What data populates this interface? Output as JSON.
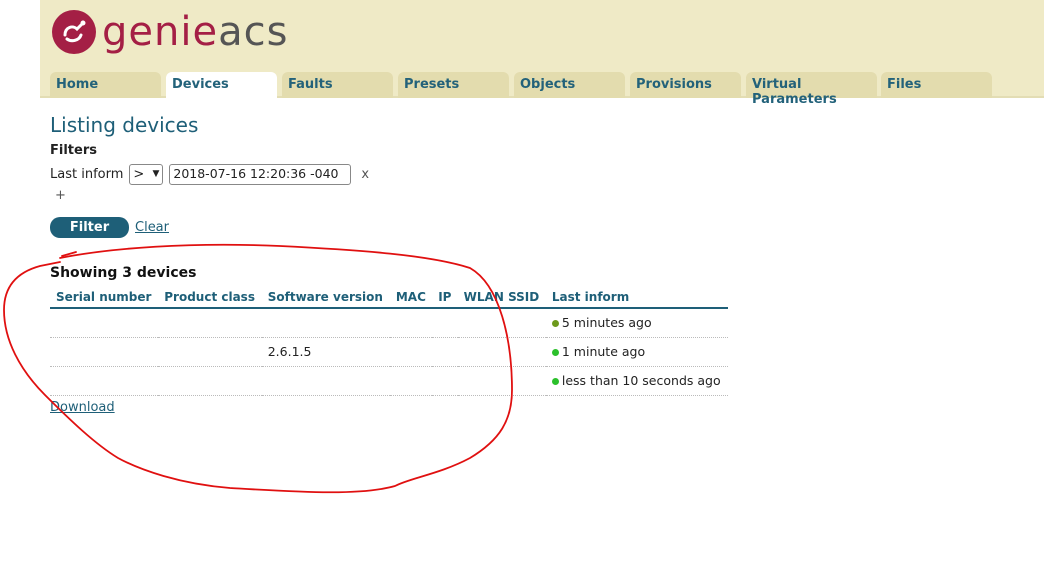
{
  "header": {
    "logo_genie": "genie",
    "logo_acs": "acs",
    "brand_color": "#a41f45"
  },
  "tabs": [
    {
      "label": "Home",
      "active": false
    },
    {
      "label": "Devices",
      "active": true
    },
    {
      "label": "Faults",
      "active": false
    },
    {
      "label": "Presets",
      "active": false
    },
    {
      "label": "Objects",
      "active": false
    },
    {
      "label": "Provisions",
      "active": false
    },
    {
      "label": "Virtual Parameters",
      "active": false
    },
    {
      "label": "Files",
      "active": false
    }
  ],
  "page": {
    "title": "Listing devices",
    "filters_label": "Filters",
    "filter": {
      "param": "Last inform",
      "operator": ">",
      "value": "2018-07-16 12:20:36 -040",
      "remove": "x",
      "add": "+"
    },
    "filter_button": "Filter",
    "clear_link": "Clear",
    "showing": "Showing 3 devices",
    "download": "Download"
  },
  "table": {
    "columns": [
      "Serial number",
      "Product class",
      "Software version",
      "MAC",
      "IP",
      "WLAN SSID",
      "Last inform"
    ],
    "rows": [
      {
        "serial": "",
        "product_class": "",
        "software_version": "",
        "mac": "",
        "ip": "",
        "wlan_ssid": "",
        "last_inform": "5 minutes ago"
      },
      {
        "serial": "",
        "product_class": "",
        "software_version": "2.6.1.5",
        "mac": "",
        "ip": "",
        "wlan_ssid": "",
        "last_inform": "1 minute ago"
      },
      {
        "serial": "",
        "product_class": "",
        "software_version": "",
        "mac": "",
        "ip": "",
        "wlan_ssid": "",
        "last_inform": "less than 10 seconds ago"
      }
    ]
  },
  "colors": {
    "header_bg": "#efeac6",
    "tab_bg": "#e3dcae",
    "accent": "#1e5f78",
    "online_dot": "#2bc02b",
    "annotation": "#e01010"
  }
}
